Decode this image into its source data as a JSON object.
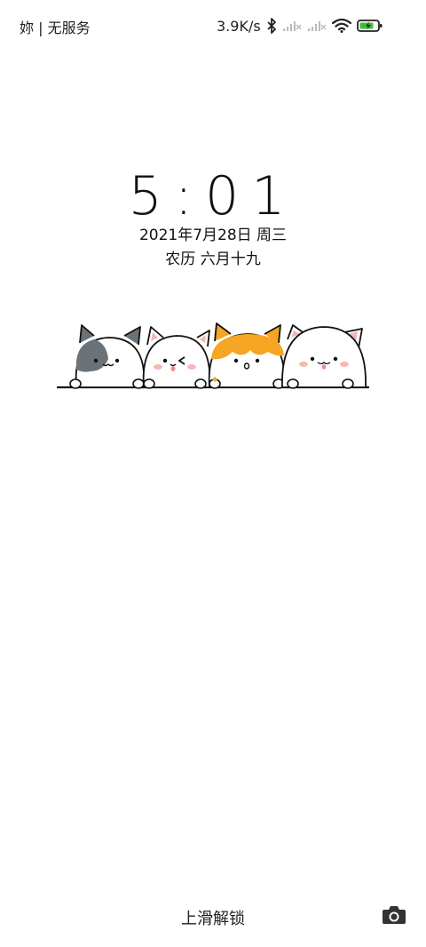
{
  "status_bar": {
    "carrier_left": "妳 | 无服务",
    "net_speed": "3.9K/s",
    "icons": [
      "bluetooth-icon",
      "signal-no-service-icon",
      "signal-no-service-icon",
      "wifi-icon",
      "battery-charging-icon"
    ]
  },
  "lockscreen": {
    "time": "5:01",
    "date": "2021年7月28日 周三",
    "lunar": "农历 六月十九",
    "wallpaper_icon": "four-cats-illustration",
    "unlock_hint": "上滑解锁",
    "camera_icon": "camera-icon"
  },
  "colors": {
    "accent_orange": "#F6A623",
    "battery_green": "#3DBE3D"
  }
}
